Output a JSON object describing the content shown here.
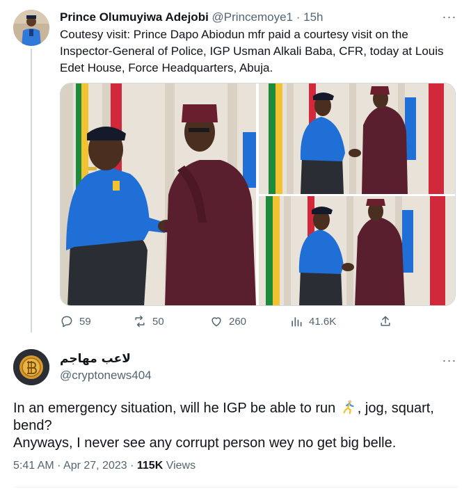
{
  "tweet1": {
    "author_name": "Prince Olumuyiwa Adejobi",
    "handle": "@Princemoye1",
    "separator": " · ",
    "time": "15h",
    "more": "···",
    "text": "Coutesy visit: Prince Dapo Abiodun mfr paid a courtesy visit on the Inspector-General of Police, IGP Usman Alkali Baba, CFR, today at Louis Edet House, Force Headquarters, Abuja.",
    "photos": [
      "handshake-photo-main",
      "handshake-photo-top-right",
      "handshake-photo-bottom-right"
    ],
    "actions": {
      "replies": "59",
      "retweets": "50",
      "likes": "260",
      "views": "41.6K"
    }
  },
  "tweet2": {
    "author_name": "لاعب مهاجم",
    "handle": "@cryptonews404",
    "more": "···",
    "text_part1": "In an emergency situation, will he IGP be able to run",
    "text_part2": ",  jog, squart, bend?",
    "text_line2": "Anyways, I never see any corrupt person wey no get big belle.",
    "emoji": "person-running-emoji",
    "timestamp": "5:41 AM · Apr 27, 2023 · ",
    "views_count": "115K",
    "views_label": " Views"
  },
  "colors": {
    "text_primary": "#0f1419",
    "text_secondary": "#536471",
    "border": "#cfd9de",
    "police_blue": "#1f6fd6",
    "agbada_maroon": "#5a1f2e"
  }
}
